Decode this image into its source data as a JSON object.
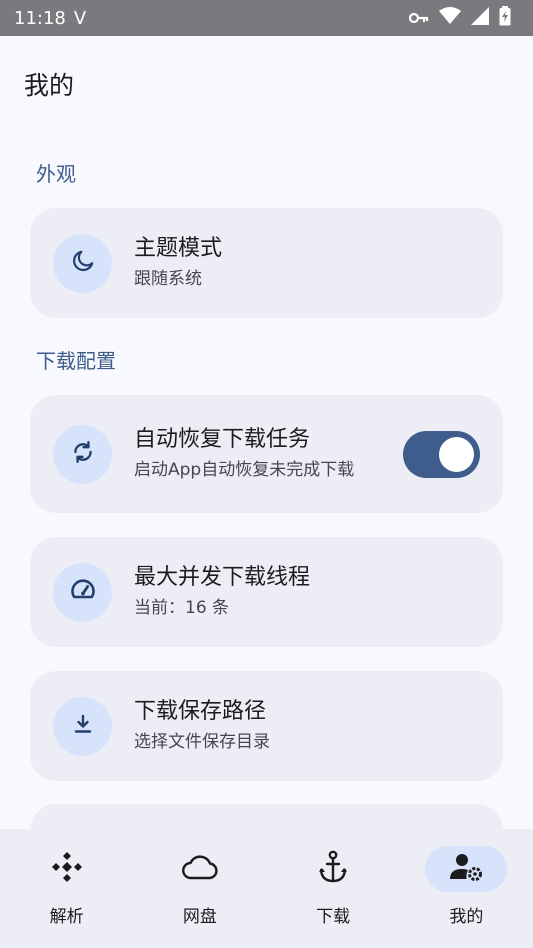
{
  "status_bar": {
    "time": "11:18",
    "carrier_glyph": "V"
  },
  "page": {
    "title": "我的"
  },
  "sections": {
    "appearance": "外观",
    "download_config": "下载配置"
  },
  "cards": {
    "theme": {
      "title": "主题模式",
      "subtitle": "跟随系统",
      "icon": "moon-icon"
    },
    "auto_resume": {
      "title": "自动恢复下载任务",
      "subtitle": "启动App自动恢复未完成下载",
      "icon": "sync-icon",
      "toggle_on": true
    },
    "max_threads": {
      "title": "最大并发下载线程",
      "subtitle": "当前：16 条",
      "icon": "speedometer-icon"
    },
    "save_path": {
      "title": "下载保存路径",
      "subtitle": "选择文件保存目录",
      "icon": "download-icon"
    }
  },
  "nav": {
    "parse": "解析",
    "cloud": "网盘",
    "download": "下载",
    "mine": "我的"
  },
  "colors": {
    "accent": "#3e5d8c",
    "icon_bg": "#d6e3fb",
    "card_bg": "#edeef5",
    "page_bg": "#f8f9fe"
  }
}
